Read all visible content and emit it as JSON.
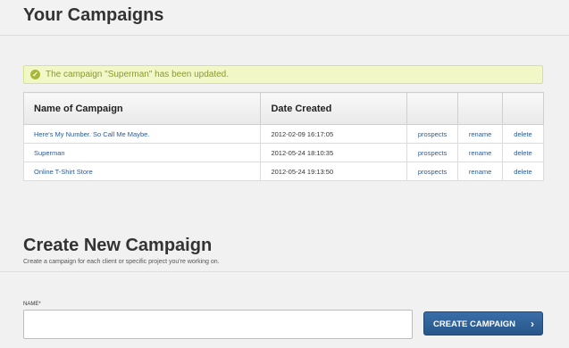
{
  "header": {
    "title": "Your Campaigns"
  },
  "banner": {
    "message": "The campaign \"Superman\" has been updated.",
    "icon": "check-circle-icon"
  },
  "table": {
    "columns": [
      "Name of Campaign",
      "Date Created",
      "",
      "",
      ""
    ],
    "rows": [
      {
        "name": "Here's My Number. So Call Me Maybe.",
        "date": "2012-02-09 16:17:05",
        "prospects": "prospects",
        "rename": "rename",
        "delete": "delete"
      },
      {
        "name": "Superman",
        "date": "2012-05-24 18:10:35",
        "prospects": "prospects",
        "rename": "rename",
        "delete": "delete"
      },
      {
        "name": "Online T-Shirt Store",
        "date": "2012-05-24 19:13:50",
        "prospects": "prospects",
        "rename": "rename",
        "delete": "delete"
      }
    ]
  },
  "create": {
    "title": "Create New Campaign",
    "subtitle": "Create a campaign for each client or specific project you're working on.",
    "name_label": "NAME*",
    "name_value": "",
    "button_label": "CREATE CAMPAIGN",
    "button_arrow": "›"
  },
  "colors": {
    "accent": "#2f6399",
    "success_bg": "#f2f7c8",
    "success_text": "#8b9a2a"
  }
}
